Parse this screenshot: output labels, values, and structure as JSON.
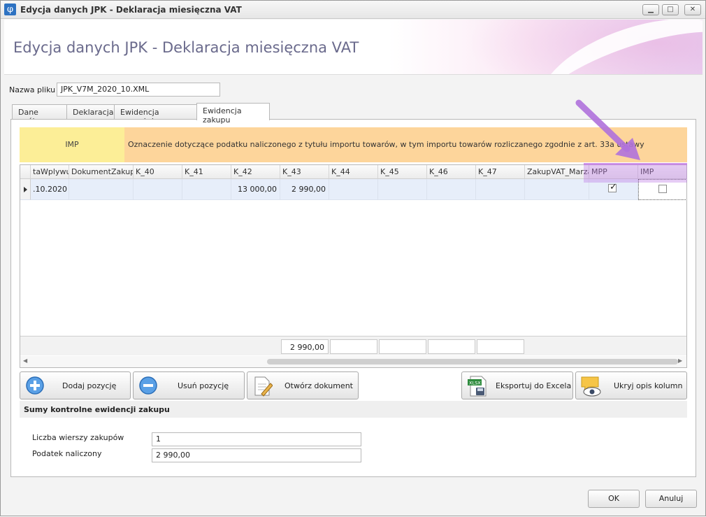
{
  "window": {
    "title": "Edycja danych JPK - Deklaracja miesięczna VAT",
    "app_icon": "φ",
    "min": "▁",
    "max": "□",
    "close": "✕"
  },
  "header": {
    "title": "Edycja danych JPK - Deklaracja miesięczna VAT"
  },
  "file": {
    "label": "Nazwa pliku",
    "value": "JPK_V7M_2020_10.XML"
  },
  "tabs": [
    {
      "label": "Dane ogólne"
    },
    {
      "label": "Deklaracja"
    },
    {
      "label": "Ewidencja sprzedaży"
    },
    {
      "label": "Ewidencja zakupu"
    }
  ],
  "info": {
    "key": "IMP",
    "description": "Oznaczenie dotyczące podatku naliczonego z tytułu importu towarów, w tym importu towarów rozliczanego zgodnie z art. 33a ustawy"
  },
  "grid": {
    "columns": [
      "taWplywu",
      "DokumentZakupu",
      "K_40",
      "K_41",
      "K_42",
      "K_43",
      "K_44",
      "K_45",
      "K_46",
      "K_47",
      "ZakupVAT_Marza",
      "MPP",
      "IMP"
    ],
    "row": {
      "taWplywu": ".10.2020",
      "DokumentZakupu": "",
      "K_40": "",
      "K_41": "",
      "K_42": "13 000,00",
      "K_43": "2 990,00",
      "K_44": "",
      "K_45": "",
      "K_46": "",
      "K_47": "",
      "ZakupVAT_Marza": "",
      "MPP": true,
      "IMP": false
    },
    "footer": [
      "2 990,00",
      "",
      "",
      "",
      ""
    ],
    "checkmark": "✓",
    "scroll_left": "◀",
    "scroll_right": "▶"
  },
  "buttons": {
    "add": "Dodaj pozycję",
    "remove": "Usuń pozycję",
    "open": "Otwórz dokument",
    "export": "Eksportuj do Excela",
    "hide": "Ukryj opis kolumn",
    "xlsx_badge": "XLSX"
  },
  "totals": {
    "title": "Sumy kontrolne ewidencji zakupu",
    "rows_label": "Liczba wierszy zakupów",
    "rows_value": "1",
    "tax_label": "Podatek naliczony",
    "tax_value": "2 990,00"
  },
  "dialog": {
    "ok": "OK",
    "cancel": "Anuluj"
  },
  "colors": {
    "highlight": "#be78e6",
    "info_key_bg": "#fcee97",
    "info_desc_bg": "#fdd59b",
    "row_bg": "#e7eefa"
  }
}
